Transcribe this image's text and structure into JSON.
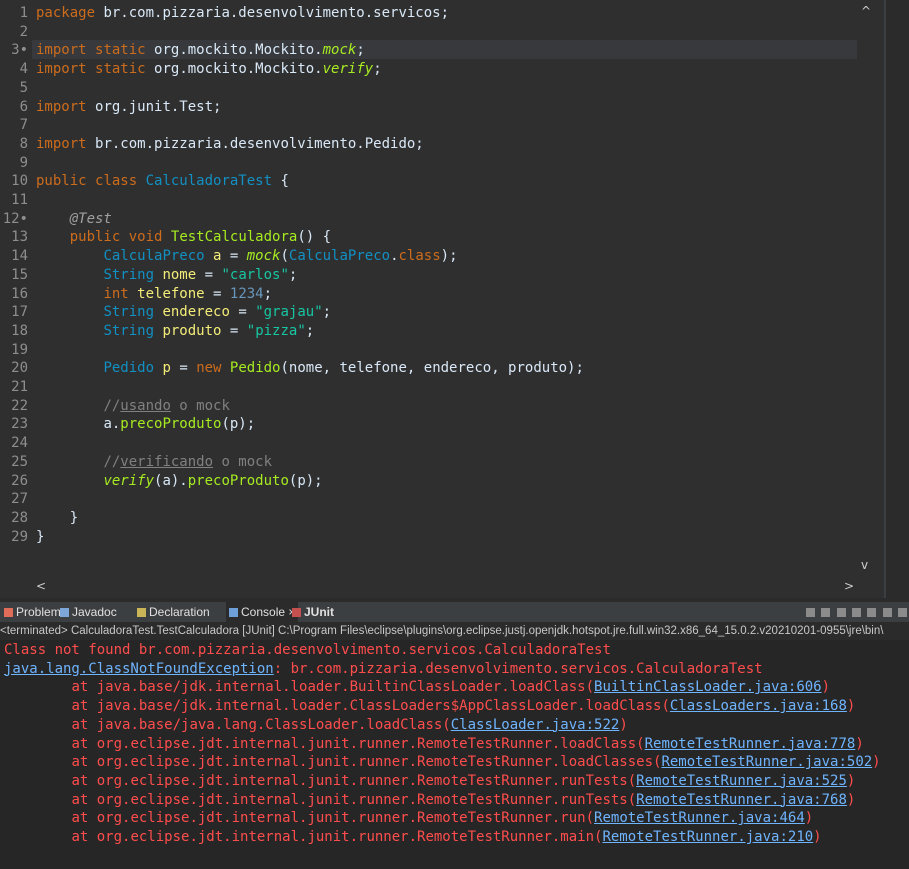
{
  "editor": {
    "lines": [
      {
        "n": "1",
        "parts": [
          {
            "t": "package ",
            "c": "kw"
          },
          {
            "t": "br.com.pizzaria.desenvolvimento.servicos;",
            "c": ""
          }
        ]
      },
      {
        "n": "2",
        "parts": []
      },
      {
        "n": "3•",
        "parts": [
          {
            "t": "import ",
            "c": "kw"
          },
          {
            "t": "static ",
            "c": "kw"
          },
          {
            "t": "org.mockito.Mockito.",
            "c": ""
          },
          {
            "t": "mock",
            "c": "smth"
          },
          {
            "t": ";",
            "c": ""
          }
        ]
      },
      {
        "n": "4",
        "parts": [
          {
            "t": "import ",
            "c": "kw"
          },
          {
            "t": "static ",
            "c": "kw"
          },
          {
            "t": "org.mockito.Mockito.",
            "c": ""
          },
          {
            "t": "verify",
            "c": "smth"
          },
          {
            "t": ";",
            "c": ""
          }
        ]
      },
      {
        "n": "5",
        "parts": []
      },
      {
        "n": "6",
        "parts": [
          {
            "t": "import ",
            "c": "kw"
          },
          {
            "t": "org.junit.Test;",
            "c": ""
          }
        ]
      },
      {
        "n": "7",
        "parts": []
      },
      {
        "n": "8",
        "parts": [
          {
            "t": "import ",
            "c": "kw"
          },
          {
            "t": "br.com.pizzaria.desenvolvimento.Pedido;",
            "c": ""
          }
        ]
      },
      {
        "n": "9",
        "parts": []
      },
      {
        "n": "10",
        "parts": [
          {
            "t": "public ",
            "c": "kw"
          },
          {
            "t": "class ",
            "c": "kw"
          },
          {
            "t": "CalculadoraTest",
            "c": "typ"
          },
          {
            "t": " {",
            "c": ""
          }
        ]
      },
      {
        "n": "11",
        "parts": []
      },
      {
        "n": "12•",
        "parts": [
          {
            "t": "    ",
            "c": ""
          },
          {
            "t": "@Test",
            "c": "ann"
          }
        ]
      },
      {
        "n": "13",
        "parts": [
          {
            "t": "    ",
            "c": ""
          },
          {
            "t": "public ",
            "c": "kw"
          },
          {
            "t": "void ",
            "c": "kw"
          },
          {
            "t": "TestCalculadora",
            "c": "mth"
          },
          {
            "t": "() {",
            "c": ""
          }
        ]
      },
      {
        "n": "14",
        "parts": [
          {
            "t": "        ",
            "c": ""
          },
          {
            "t": "CalculaPreco ",
            "c": "typ"
          },
          {
            "t": "a",
            "c": "var"
          },
          {
            "t": " = ",
            "c": ""
          },
          {
            "t": "mock",
            "c": "smth"
          },
          {
            "t": "(",
            "c": ""
          },
          {
            "t": "CalculaPreco",
            "c": "typ"
          },
          {
            "t": ".",
            "c": ""
          },
          {
            "t": "class",
            "c": "kw"
          },
          {
            "t": ");",
            "c": ""
          }
        ]
      },
      {
        "n": "15",
        "parts": [
          {
            "t": "        ",
            "c": ""
          },
          {
            "t": "String ",
            "c": "typ"
          },
          {
            "t": "nome",
            "c": "var"
          },
          {
            "t": " = ",
            "c": ""
          },
          {
            "t": "\"carlos\"",
            "c": "str"
          },
          {
            "t": ";",
            "c": ""
          }
        ]
      },
      {
        "n": "16",
        "parts": [
          {
            "t": "        ",
            "c": ""
          },
          {
            "t": "int ",
            "c": "kw"
          },
          {
            "t": "telefone",
            "c": "var"
          },
          {
            "t": " = ",
            "c": ""
          },
          {
            "t": "1234",
            "c": "num"
          },
          {
            "t": ";",
            "c": ""
          }
        ]
      },
      {
        "n": "17",
        "parts": [
          {
            "t": "        ",
            "c": ""
          },
          {
            "t": "String ",
            "c": "typ"
          },
          {
            "t": "endereco",
            "c": "var"
          },
          {
            "t": " = ",
            "c": ""
          },
          {
            "t": "\"grajau\"",
            "c": "str"
          },
          {
            "t": ";",
            "c": ""
          }
        ]
      },
      {
        "n": "18",
        "parts": [
          {
            "t": "        ",
            "c": ""
          },
          {
            "t": "String ",
            "c": "typ"
          },
          {
            "t": "produto",
            "c": "var"
          },
          {
            "t": " = ",
            "c": ""
          },
          {
            "t": "\"pizza\"",
            "c": "str"
          },
          {
            "t": ";",
            "c": ""
          }
        ]
      },
      {
        "n": "19",
        "parts": []
      },
      {
        "n": "20",
        "parts": [
          {
            "t": "        ",
            "c": ""
          },
          {
            "t": "Pedido ",
            "c": "typ"
          },
          {
            "t": "p",
            "c": "var"
          },
          {
            "t": " = ",
            "c": ""
          },
          {
            "t": "new ",
            "c": "kw"
          },
          {
            "t": "Pedido",
            "c": "mth"
          },
          {
            "t": "(nome, telefone, endereco, produto);",
            "c": ""
          }
        ]
      },
      {
        "n": "21",
        "parts": []
      },
      {
        "n": "22",
        "parts": [
          {
            "t": "        ",
            "c": ""
          },
          {
            "t": "//",
            "c": "cmt"
          },
          {
            "t": "usando",
            "c": "cmtu"
          },
          {
            "t": " o mock",
            "c": "cmt"
          }
        ]
      },
      {
        "n": "23",
        "parts": [
          {
            "t": "        ",
            "c": ""
          },
          {
            "t": "a.",
            "c": ""
          },
          {
            "t": "precoProduto",
            "c": "mth"
          },
          {
            "t": "(p);",
            "c": ""
          }
        ]
      },
      {
        "n": "24",
        "parts": []
      },
      {
        "n": "25",
        "parts": [
          {
            "t": "        ",
            "c": ""
          },
          {
            "t": "//",
            "c": "cmt"
          },
          {
            "t": "verificando",
            "c": "cmtu"
          },
          {
            "t": " o mock",
            "c": "cmt"
          }
        ]
      },
      {
        "n": "26",
        "parts": [
          {
            "t": "        ",
            "c": ""
          },
          {
            "t": "verify",
            "c": "smth"
          },
          {
            "t": "(a).",
            "c": ""
          },
          {
            "t": "precoProduto",
            "c": "mth"
          },
          {
            "t": "(p);",
            "c": ""
          }
        ]
      },
      {
        "n": "27",
        "parts": []
      },
      {
        "n": "28",
        "parts": [
          {
            "t": "    }",
            "c": ""
          }
        ]
      },
      {
        "n": "29",
        "parts": [
          {
            "t": "}",
            "c": ""
          }
        ]
      }
    ],
    "vscroll_up": "^",
    "vscroll_down": "v",
    "hscroll_left": "<",
    "hscroll_right": ">"
  },
  "panel": {
    "tabs": [
      {
        "label": "Problems",
        "icon": "problems-icon",
        "color": "#e06c5a"
      },
      {
        "label": "Javadoc",
        "icon": "javadoc-icon",
        "color": "#7da7d9"
      },
      {
        "label": "Declaration",
        "icon": "declaration-icon",
        "color": "#c9b458"
      },
      {
        "label": "Console ×",
        "icon": "console-icon",
        "color": "#6f9fd8",
        "active": true
      },
      {
        "label": "JUnit",
        "icon": "junit-icon",
        "color": "#c45050"
      }
    ],
    "terminated": "<terminated> CalculadoraTest.TestCalculadora [JUnit] C:\\Program Files\\eclipse\\plugins\\org.eclipse.justj.openjdk.hotspot.jre.full.win32.x86_64_15.0.2.v20210201-0955\\jre\\bin\\"
  },
  "console": {
    "lines": [
      [
        {
          "t": "Class not found br.com.pizzaria.desenvolvimento.servicos.CalculadoraTest",
          "c": "plain"
        }
      ],
      [
        {
          "t": "java.lang.ClassNotFoundException",
          "c": "link"
        },
        {
          "t": ": br.com.pizzaria.desenvolvimento.servicos.CalculadoraTest",
          "c": "plain"
        }
      ],
      [
        {
          "t": "\tat java.base/jdk.internal.loader.BuiltinClassLoader.loadClass(",
          "c": "plain"
        },
        {
          "t": "BuiltinClassLoader.java:606",
          "c": "link"
        },
        {
          "t": ")",
          "c": "plain"
        }
      ],
      [
        {
          "t": "\tat java.base/jdk.internal.loader.ClassLoaders$AppClassLoader.loadClass(",
          "c": "plain"
        },
        {
          "t": "ClassLoaders.java:168",
          "c": "link"
        },
        {
          "t": ")",
          "c": "plain"
        }
      ],
      [
        {
          "t": "\tat java.base/java.lang.ClassLoader.loadClass(",
          "c": "plain"
        },
        {
          "t": "ClassLoader.java:522",
          "c": "link"
        },
        {
          "t": ")",
          "c": "plain"
        }
      ],
      [
        {
          "t": "\tat org.eclipse.jdt.internal.junit.runner.RemoteTestRunner.loadClass(",
          "c": "plain"
        },
        {
          "t": "RemoteTestRunner.java:778",
          "c": "link"
        },
        {
          "t": ")",
          "c": "plain"
        }
      ],
      [
        {
          "t": "\tat org.eclipse.jdt.internal.junit.runner.RemoteTestRunner.loadClasses(",
          "c": "plain"
        },
        {
          "t": "RemoteTestRunner.java:502",
          "c": "link"
        },
        {
          "t": ")",
          "c": "plain"
        }
      ],
      [
        {
          "t": "\tat org.eclipse.jdt.internal.junit.runner.RemoteTestRunner.runTests(",
          "c": "plain"
        },
        {
          "t": "RemoteTestRunner.java:525",
          "c": "link"
        },
        {
          "t": ")",
          "c": "plain"
        }
      ],
      [
        {
          "t": "\tat org.eclipse.jdt.internal.junit.runner.RemoteTestRunner.runTests(",
          "c": "plain"
        },
        {
          "t": "RemoteTestRunner.java:768",
          "c": "link"
        },
        {
          "t": ")",
          "c": "plain"
        }
      ],
      [
        {
          "t": "\tat org.eclipse.jdt.internal.junit.runner.RemoteTestRunner.run(",
          "c": "plain"
        },
        {
          "t": "RemoteTestRunner.java:464",
          "c": "link"
        },
        {
          "t": ")",
          "c": "plain"
        }
      ],
      [
        {
          "t": "\tat org.eclipse.jdt.internal.junit.runner.RemoteTestRunner.main(",
          "c": "plain"
        },
        {
          "t": "RemoteTestRunner.java:210",
          "c": "link"
        },
        {
          "t": ")",
          "c": "plain"
        }
      ]
    ]
  }
}
